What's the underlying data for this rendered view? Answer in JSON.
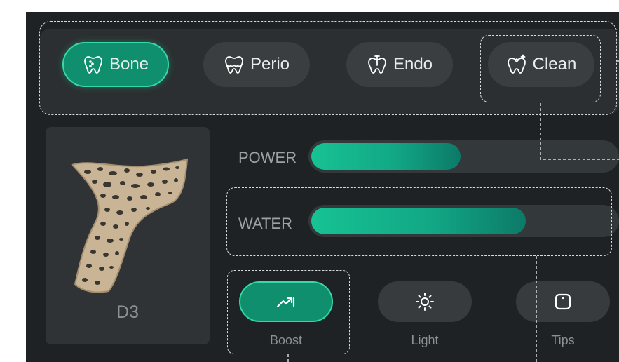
{
  "modes": {
    "items": [
      {
        "label": "Bone",
        "icon": "tooth-bone-icon",
        "active": true
      },
      {
        "label": "Perio",
        "icon": "tooth-perio-icon",
        "active": false
      },
      {
        "label": "Endo",
        "icon": "tooth-endo-icon",
        "active": false
      },
      {
        "label": "Clean",
        "icon": "tooth-clean-icon",
        "active": false
      }
    ]
  },
  "bone_density": {
    "label": "D3",
    "icon": "bone-density-illustration"
  },
  "sliders": [
    {
      "label": "POWER",
      "value_percent": 49
    },
    {
      "label": "WATER",
      "value_percent": 70
    }
  ],
  "quick_actions": [
    {
      "label": "Boost",
      "icon": "boost-trend-icon",
      "active": true
    },
    {
      "label": "Light",
      "icon": "sun-icon",
      "active": false
    },
    {
      "label": "Tips",
      "icon": "tips-square-icon",
      "active": false
    }
  ],
  "colors": {
    "background": "#1f2224",
    "accent": "#17c293",
    "accent_border": "#34d9a8",
    "inactive_button": "#3a3e40",
    "bone": "#c9b596"
  }
}
